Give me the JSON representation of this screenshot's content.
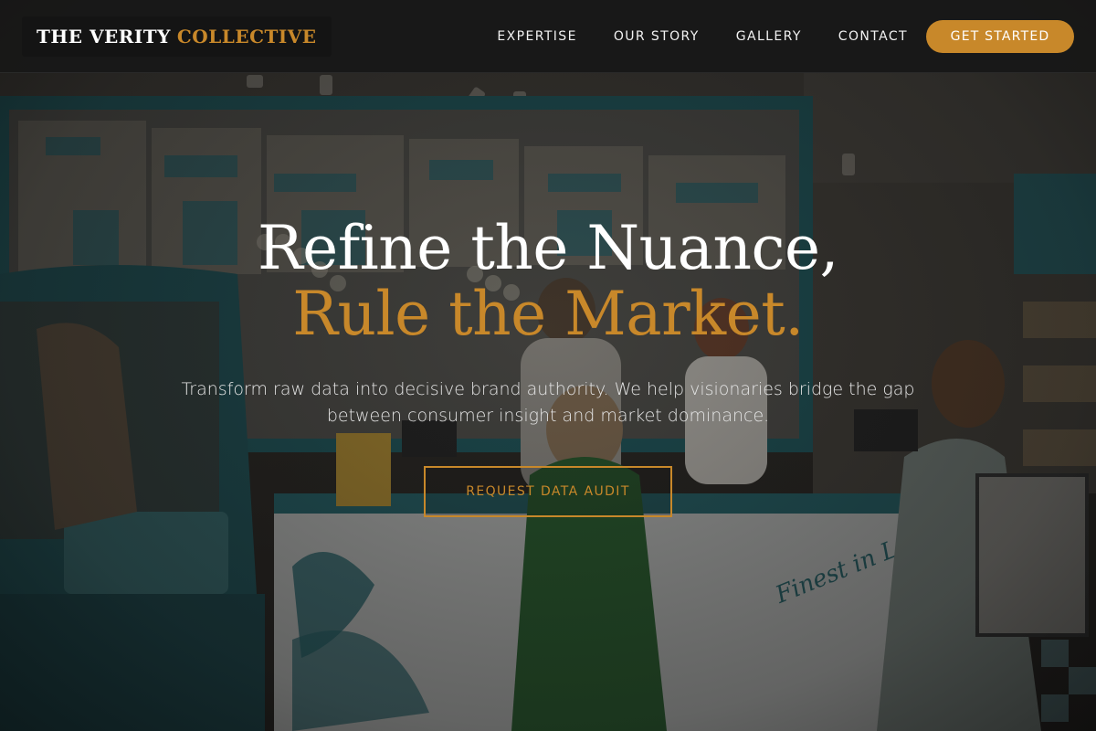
{
  "brand": {
    "name_main": "THE VERITY",
    "name_accent": "COLLECTIVE"
  },
  "nav": {
    "items": [
      {
        "label": "EXPERTISE"
      },
      {
        "label": "OUR STORY"
      },
      {
        "label": "GALLERY"
      },
      {
        "label": "CONTACT"
      }
    ],
    "cta_label": "GET STARTED"
  },
  "hero": {
    "title_line1": "Refine the Nuance,",
    "title_line2": "Rule the Market.",
    "subtitle": "Transform raw data into decisive brand authority. We help visionaries bridge the gap between consumer insight and market dominance.",
    "button_label": "REQUEST DATA AUDIT",
    "background_image": {
      "label_1": "Finest in London!"
    }
  },
  "colors": {
    "accent": "#c8882a",
    "header_bg": "#181818",
    "text_primary": "#ffffff",
    "teal": "#2f7f86"
  }
}
